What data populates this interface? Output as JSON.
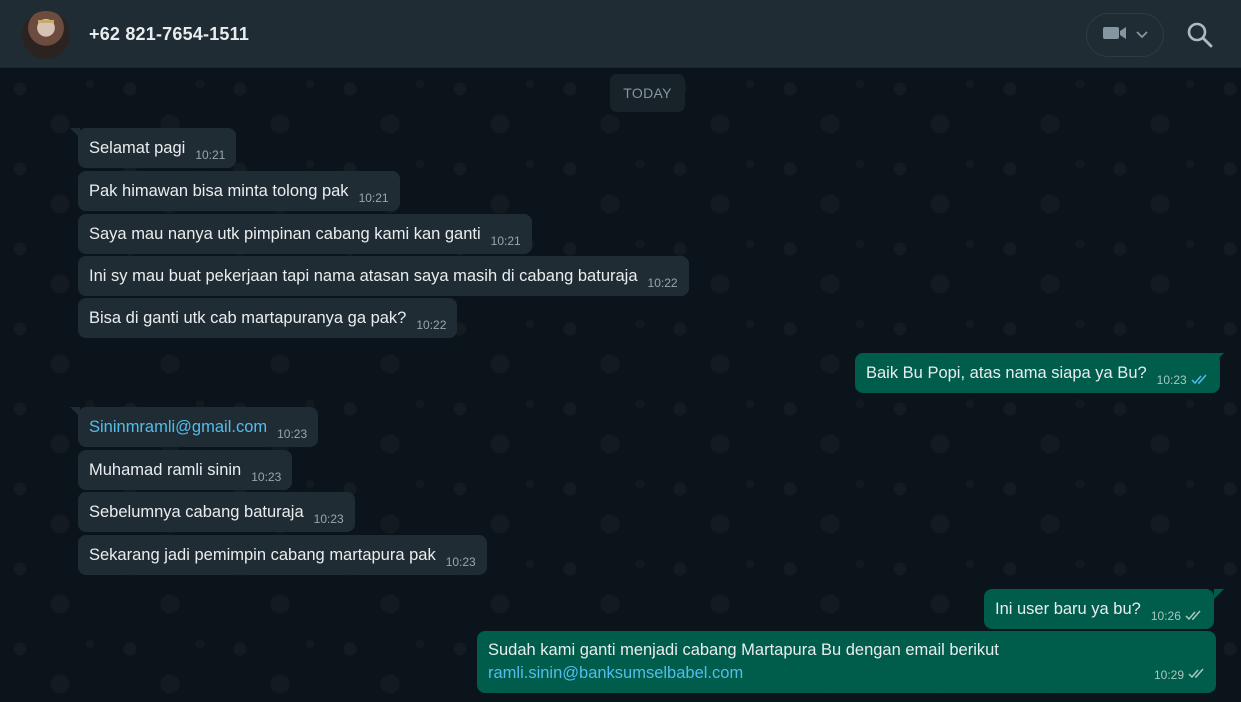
{
  "header": {
    "contact": "+62 821-7654-1511"
  },
  "day_chip": "TODAY",
  "messages": [
    {
      "text": "Selamat pagi",
      "time": "10:21"
    },
    {
      "text": "Pak himawan bisa minta tolong pak",
      "time": "10:21"
    },
    {
      "text": "Saya mau nanya utk pimpinan cabang kami kan ganti",
      "time": "10:21"
    },
    {
      "text": "Ini sy mau buat pekerjaan tapi nama atasan saya masih di cabang baturaja",
      "time": "10:22"
    },
    {
      "text": "Bisa di ganti utk cab martapuranya ga pak?",
      "time": "10:22"
    },
    {
      "text": "Baik Bu Popi, atas nama siapa ya Bu?",
      "time": "10:23"
    },
    {
      "text": "Sininmramli@gmail.com",
      "time": "10:23"
    },
    {
      "text": "Muhamad ramli sinin",
      "time": "10:23"
    },
    {
      "text": "Sebelumnya cabang baturaja",
      "time": "10:23"
    },
    {
      "text": "Sekarang jadi pemimpin cabang martapura pak",
      "time": "10:23"
    },
    {
      "text": "Ini user baru ya bu?",
      "time": "10:26"
    },
    {
      "text": "Sudah kami ganti menjadi cabang Martapura Bu dengan email berikut",
      "link": "ramli.sinin@banksumselbabel.com",
      "time": "10:29"
    }
  ],
  "colors": {
    "incoming_bubble": "#202c33",
    "outgoing_bubble": "#005c4b",
    "link": "#53bdeb",
    "read_ticks": "#53bdeb"
  },
  "icons": [
    "video-call-icon",
    "chevron-down-icon",
    "search-icon",
    "double-check-icon"
  ]
}
